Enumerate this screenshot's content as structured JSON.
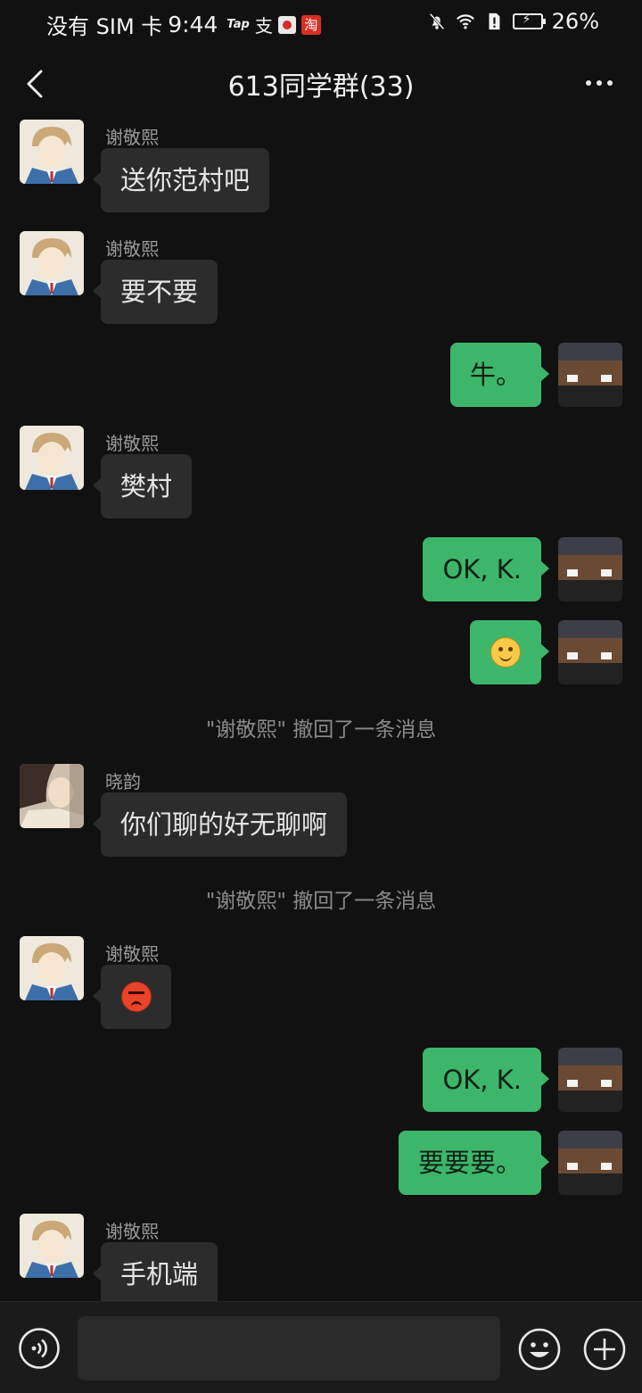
{
  "status_bar": {
    "carrier": "没有 SIM 卡",
    "time": "9:44",
    "apps": {
      "tap": "Tap",
      "zhi": "支",
      "tao": "淘"
    },
    "battery": "26%"
  },
  "header": {
    "title": "613同学群(33)",
    "back_icon": "chevron-left-icon",
    "more_icon": "more-dots-icon"
  },
  "messages": [
    {
      "sender": "谢敬熙",
      "text": "送你范村吧",
      "direction": "in"
    },
    {
      "sender": "谢敬熙",
      "text": "要不要",
      "direction": "in"
    },
    {
      "text": "牛。",
      "direction": "out"
    },
    {
      "sender": "谢敬熙",
      "text": "樊村",
      "direction": "in"
    },
    {
      "text": "OK, K.",
      "direction": "out"
    },
    {
      "emoji": "smile-emoji",
      "direction": "out"
    },
    {
      "system": "\"谢敬熙\" 撤回了一条消息"
    },
    {
      "sender": "晓韵",
      "text": "你们聊的好无聊啊",
      "direction": "in"
    },
    {
      "system": "\"谢敬熙\" 撤回了一条消息"
    },
    {
      "sender": "谢敬熙",
      "emoji": "angry-emoji",
      "direction": "in"
    },
    {
      "text": "OK, K.",
      "direction": "out"
    },
    {
      "text": "要要要。",
      "direction": "out"
    },
    {
      "sender": "谢敬熙",
      "text": "手机端",
      "direction": "in"
    }
  ],
  "colors": {
    "background": "#111111",
    "bubble_in": "#2c2c2c",
    "bubble_out": "#3db66b",
    "system_text": "#8a8a8a"
  },
  "input": {
    "value": "",
    "placeholder": ""
  },
  "bottom_bar": {
    "voice_icon": "voice-icon",
    "emoji_icon": "emoji-icon",
    "plus_icon": "plus-circle-icon"
  }
}
